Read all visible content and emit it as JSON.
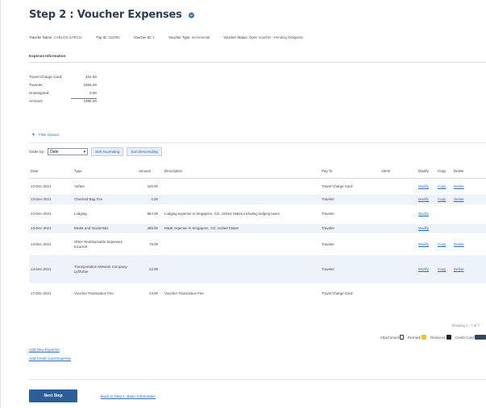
{
  "page": {
    "title": "Step 2 : Voucher Expenses",
    "help_icon": "help-circle-icon"
  },
  "meta": [
    {
      "label": "Traveler Name:",
      "value": "CARLOS GARCIA"
    },
    {
      "label": "Trip ID:",
      "value": "222093"
    },
    {
      "label": "Voucher ID:",
      "value": "1"
    },
    {
      "label": "Voucher Type:",
      "value": "Incremental"
    },
    {
      "label": "Voucher Status:",
      "value": "Open Voucher - Pending Obligation"
    }
  ],
  "expense_info": {
    "header": "Expense Information",
    "rows": [
      {
        "label": "Travel Charge Card:",
        "value": "431.00"
      },
      {
        "label": "Traveler:",
        "value": "1555.00"
      },
      {
        "label": "Unassigned:",
        "value": "0.00"
      },
      {
        "label": "Amount:",
        "value": "1986.00"
      }
    ]
  },
  "filter": {
    "label": "Filter Options"
  },
  "order": {
    "label": "Order by:",
    "selected": "Date",
    "sort_asc": "Sort Ascending",
    "sort_desc": "Sort Descending"
  },
  "table": {
    "columns": [
      "Date",
      "Type",
      "Amount",
      "Description",
      "Pay To",
      "Alerts",
      "Modify",
      "Copy",
      "Delete"
    ],
    "rows": [
      {
        "date": "13-Dec-2021",
        "type": "Airfare",
        "amount": "426.00",
        "description": "",
        "pay_to": "Travel Charge Card",
        "modify": "Modify",
        "copy": "Copy",
        "delete": "Delete"
      },
      {
        "date": "13-Dec-2021",
        "type": "Checked Bag Fee",
        "amount": "0.00",
        "description": "",
        "pay_to": "Traveler",
        "modify": "Modify",
        "copy": "Copy",
        "delete": "Delete"
      },
      {
        "date": "13-Dec-2021",
        "type": "Lodging",
        "amount": "984.00",
        "description": "Lodging expense in Singapore, CO, United States including lodging taxes",
        "pay_to": "Traveler",
        "modify": "Modify",
        "copy": "",
        "delete": ""
      },
      {
        "date": "13-Dec-2021",
        "type": "Meals and Incidentals",
        "amount": "285.00",
        "description": "M&IE expense in Singapore, CO, United States",
        "pay_to": "Traveler",
        "modify": "Modify",
        "copy": "",
        "delete": ""
      },
      {
        "date": "13-Dec-2021",
        "type": "Other Reimbursable Expenses Incurred",
        "amount": "79.00",
        "description": "",
        "pay_to": "Traveler",
        "modify": "Modify",
        "copy": "Copy",
        "delete": "Delete"
      },
      {
        "date": "13-Dec-2021",
        "type": "Transportation Network Company-Lyft/Uber",
        "amount": "22.00",
        "description": "",
        "pay_to": "Traveler",
        "modify": "Modify",
        "copy": "Copy",
        "delete": "Delete"
      },
      {
        "date": "17-Dec-2021",
        "type": "Voucher Transaction Fee",
        "amount": "14.00",
        "description": "Voucher Transaction Fee",
        "pay_to": "Travel Charge Card",
        "modify": "",
        "copy": "",
        "delete": ""
      }
    ]
  },
  "showing": "Showing 1 - 7 of 7",
  "legend": {
    "attachment": "Attachment",
    "remark": "Remark",
    "reduced": "Reduced",
    "credit_card": "Credit Card"
  },
  "links": {
    "add_expense": "Add New Expense",
    "add_cc": "Add Credit Card Expense",
    "back": "Back to Step 1: Basic Information"
  },
  "buttons": {
    "next": "Next Step"
  },
  "colors": {
    "title": "#2c3e57",
    "link": "#2f6db3",
    "primary_button": "#2d5e9c",
    "row_band": "#eef3f9",
    "remark": "#f3c227"
  }
}
